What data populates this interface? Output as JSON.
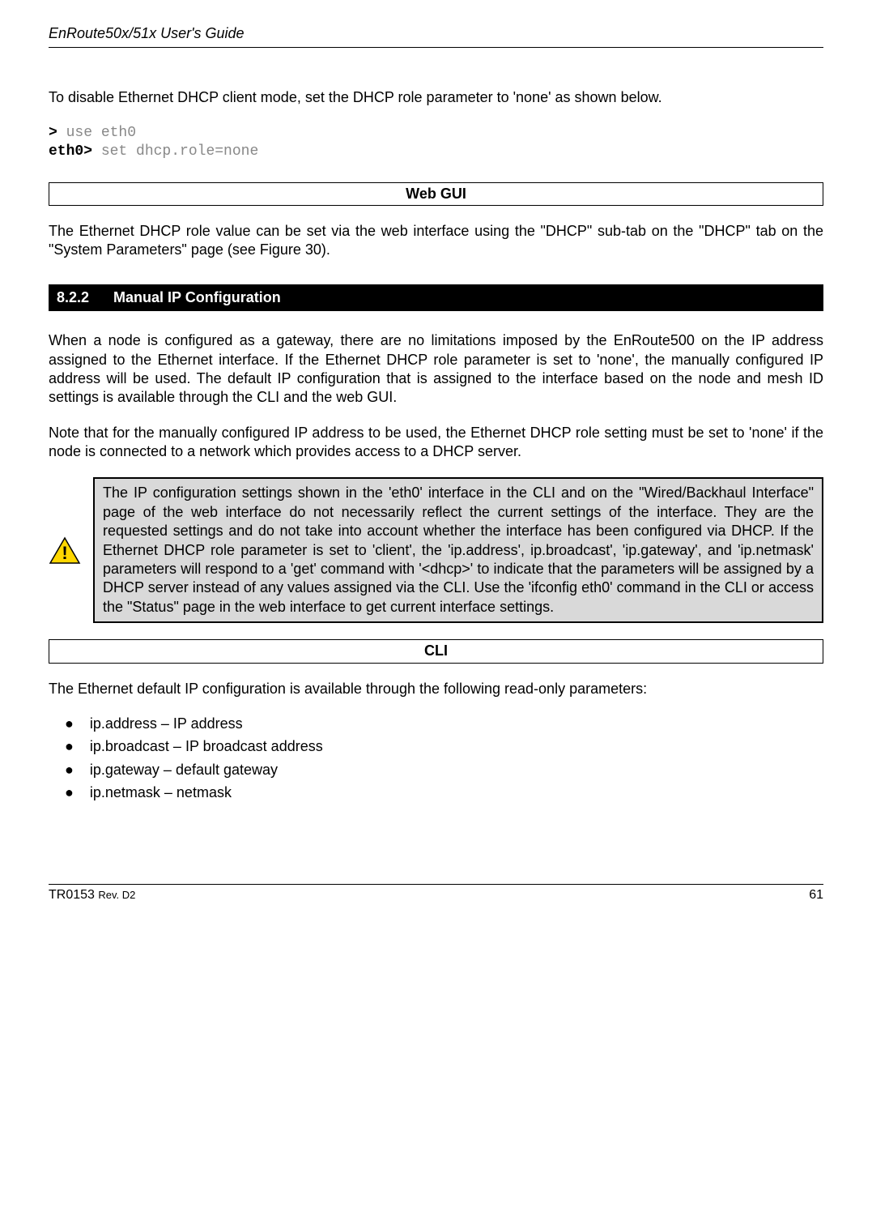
{
  "header": "EnRoute50x/51x User's Guide",
  "intro": "To disable Ethernet DHCP client mode, set the DHCP role parameter to 'none' as shown below.",
  "code": {
    "prompt1": ">",
    "cmd1": " use eth0",
    "prompt2": "eth0>",
    "cmd2": " set dhcp.role=none"
  },
  "webgui_label": "Web GUI",
  "webgui_text": "The Ethernet DHCP role value can be set via the web interface using the \"DHCP\" sub-tab on the \"DHCP\" tab on the \"System Parameters\" page (see Figure 30).",
  "section": {
    "num": "8.2.2",
    "title": "Manual IP Configuration"
  },
  "para1": "When a node is configured as a gateway, there are no limitations imposed by the EnRoute500 on the IP address assigned to the Ethernet interface. If the Ethernet DHCP role parameter is set to 'none', the manually configured IP address will be used. The default IP configuration that is assigned to the interface based on the node and mesh ID settings is available through the CLI and the web GUI.",
  "para2": "Note that for the manually configured  IP address to be used, the Ethernet DHCP role setting must be set to 'none' if the node is connected to a network which provides access to a DHCP server.",
  "warning": "The IP configuration settings shown in the 'eth0' interface in the CLI and on the \"Wired/Backhaul Interface\" page of the web interface do not necessarily reflect the current settings of the interface. They are the requested settings and do not take into account whether the interface has been configured via DHCP. If the Ethernet DHCP role parameter is set to 'client', the 'ip.address', ip.broadcast', 'ip.gateway', and 'ip.netmask' parameters will respond to a 'get' command with '<dhcp>' to indicate that the parameters will be assigned by a DHCP server instead of any values assigned via the CLI. Use the 'ifconfig eth0' command in the CLI or access the \"Status\" page in the web interface to get current interface settings.",
  "cli_label": "CLI",
  "cli_text": "The Ethernet default IP configuration is available through the following read-only parameters:",
  "list": {
    "item1": "ip.address – IP address",
    "item2": "ip.broadcast – IP broadcast address",
    "item3": "ip.gateway – default gateway",
    "item4": "ip.netmask – netmask"
  },
  "footer": {
    "doc": "TR0153 ",
    "rev": "Rev. D2",
    "page": "61"
  }
}
